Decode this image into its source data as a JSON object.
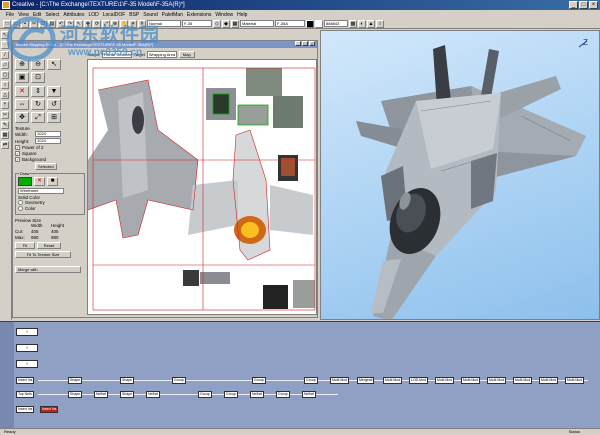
{
  "window": {
    "title": "Creative - [C:\\The Exchange\\TEXTURE\\1\\F-35 Model\\F-35A(R)*]",
    "controls": [
      "_",
      "□",
      "×"
    ]
  },
  "menu": [
    "File",
    "View",
    "Edit",
    "Select",
    "Attributes",
    "LOD",
    "LocalDOF",
    "BSP",
    "Sound",
    "PaletMan",
    "Extensions",
    "Window",
    "Help"
  ],
  "toolbar": {
    "selects": [
      "Normal",
      "F-35",
      "Material",
      "F-35A"
    ],
    "field_value": "888843"
  },
  "editor": {
    "title": "Texture Mapping Editor - [C:\\The Exchange\\TEXTURE\\F-35 Model\\F-35A(R)*]",
    "source_label": "Source",
    "source_value": "Planar Geometry",
    "target_label": "Target",
    "target_value": "Wrapping Area",
    "map_button": "Map",
    "texture_section": "Texture",
    "width_label": "Width:",
    "width_value": "1024",
    "height_label": "Height:",
    "height_value": "1024",
    "power_of_2": "Power of 2",
    "square": "Square",
    "background": "Background",
    "selected": "Selected",
    "draw_group": "Draw",
    "color_mode": "Wireframe",
    "solid_color": "Solid Color",
    "radio_geometry": "Geometry",
    "radio_color": "Color",
    "preview_size": "Preview Size",
    "col_width": "Width",
    "col_height": "Height",
    "cur_label": "Cur:",
    "cur_w": "405",
    "cur_h": "405",
    "max_label": "Max:",
    "max_w": "980",
    "max_h": "980",
    "fit_button": "Fit",
    "reset_button": "Reset",
    "fit_texture_button": "Fit To Texture Size",
    "merge_label": "Merge with"
  },
  "schematic": {
    "side_nodes": [
      "+",
      "+",
      "+",
      "Insert Ins",
      "Top Nefs",
      "Insert Ins"
    ],
    "row1": [
      "Insert Ins",
      "Shape",
      "Shape",
      "Group",
      "Group",
      "Group",
      "Multi Mod",
      "Mergeall",
      "Multi Mod",
      "LOD Mod",
      "Multi Mod",
      "Multi Mod",
      "Multi Mod",
      "Multi Mod",
      "Multi Mod",
      "Multi Mod",
      "Multi Mod"
    ],
    "row2": [
      "Top Nefs",
      "Shape",
      "Nefhel",
      "Shape",
      "Nefhel",
      "Group",
      "Group",
      "Nefhel",
      "Group",
      "Nefhel",
      "Group"
    ],
    "row3": [
      "Insert Ins",
      "Insert Ins"
    ]
  },
  "status": {
    "left": "Ready",
    "right": "Status"
  },
  "watermark": {
    "title": "河东软件园",
    "url": "www.pc0359.cn"
  },
  "colors": {
    "viewport_bg": "#a8d0f3",
    "schematic_bg": "#8fa0c4",
    "title_bar": "#0a246a",
    "draw_swatch": "#00b000"
  }
}
